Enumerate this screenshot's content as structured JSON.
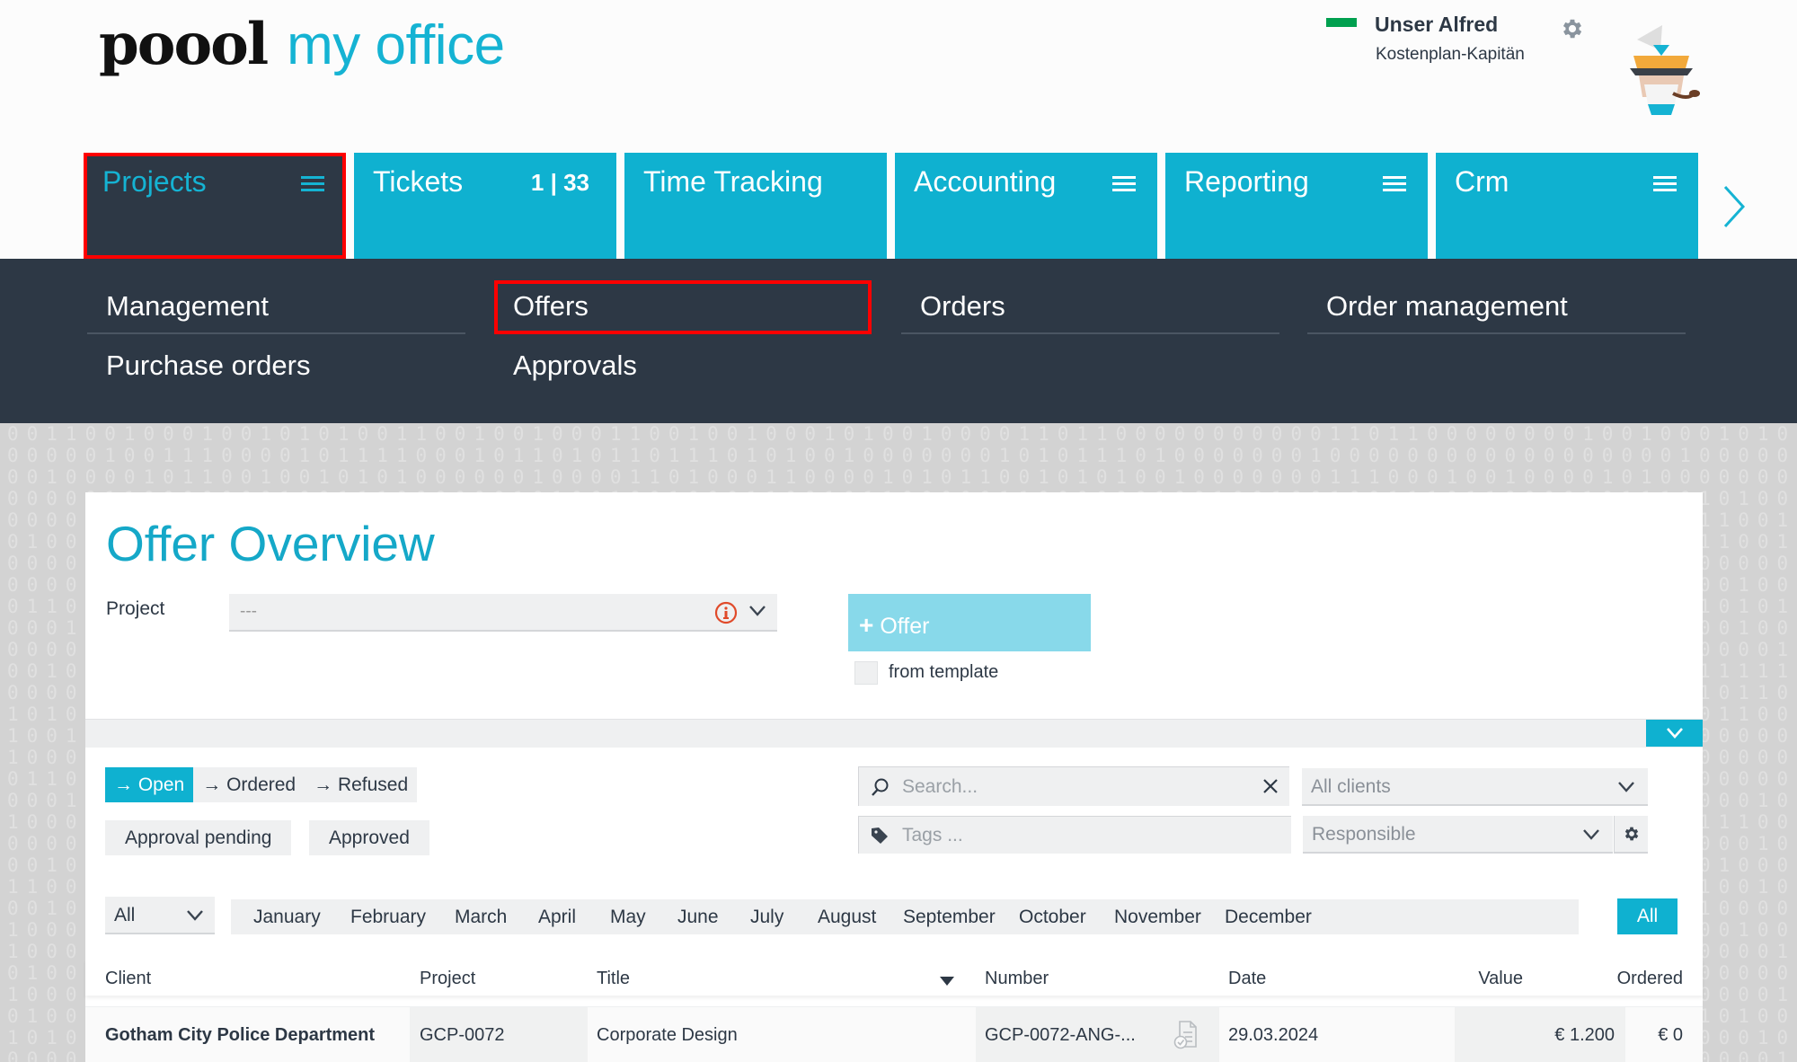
{
  "header": {
    "logo_brand": "poool",
    "logo_product": "my office",
    "user_name": "Unser Alfred",
    "user_role": "Kostenplan-Kapitän",
    "status_color": "#00a04f"
  },
  "colors": {
    "accent": "#0fb1d0",
    "dark": "#2d3845",
    "highlight": "#ff0000",
    "offer_button": "#88d9ea",
    "warning": "#e04a2a"
  },
  "tabs": [
    {
      "label": "Projects",
      "count": "",
      "has_menu": true,
      "active": true
    },
    {
      "label": "Tickets",
      "count": "1 | 33",
      "has_menu": false,
      "active": false
    },
    {
      "label": "Time Tracking",
      "count": "",
      "has_menu": false,
      "active": false
    },
    {
      "label": "Accounting",
      "count": "",
      "has_menu": true,
      "active": false
    },
    {
      "label": "Reporting",
      "count": "",
      "has_menu": true,
      "active": false
    },
    {
      "label": "Crm",
      "count": "",
      "has_menu": true,
      "active": false
    }
  ],
  "submenu": [
    {
      "label": "Management"
    },
    {
      "label": "Offers",
      "highlighted": true
    },
    {
      "label": "Orders"
    },
    {
      "label": "Order management"
    },
    {
      "label": "Purchase orders"
    },
    {
      "label": "Approvals"
    }
  ],
  "page": {
    "title": "Offer Overview",
    "project_label": "Project",
    "project_value": "---",
    "offer_button": "Offer",
    "from_template_label": "from template",
    "from_template_checked": false
  },
  "filters": {
    "status": [
      {
        "label": "Open",
        "active": true
      },
      {
        "label": "Ordered",
        "active": false
      },
      {
        "label": "Refused",
        "active": false
      }
    ],
    "approval": [
      {
        "label": "Approval pending"
      },
      {
        "label": "Approved"
      }
    ],
    "search_placeholder": "Search...",
    "tags_placeholder": "Tags ...",
    "client_value": "All clients",
    "responsible_value": "Responsible",
    "year_value": "All",
    "months": [
      "January",
      "February",
      "March",
      "April",
      "May",
      "June",
      "July",
      "August",
      "September",
      "October",
      "November",
      "December"
    ],
    "all_months_label": "All"
  },
  "table": {
    "columns": [
      "Client",
      "Project",
      "Title",
      "Number",
      "Date",
      "Value",
      "Ordered"
    ],
    "rows": [
      {
        "client": "Gotham City Police Department",
        "project": "GCP-0072",
        "title": "Corporate Design",
        "number": "GCP-0072-ANG-...",
        "date": "29.03.2024",
        "value": "€ 1.200",
        "ordered": "€ 0"
      }
    ]
  }
}
